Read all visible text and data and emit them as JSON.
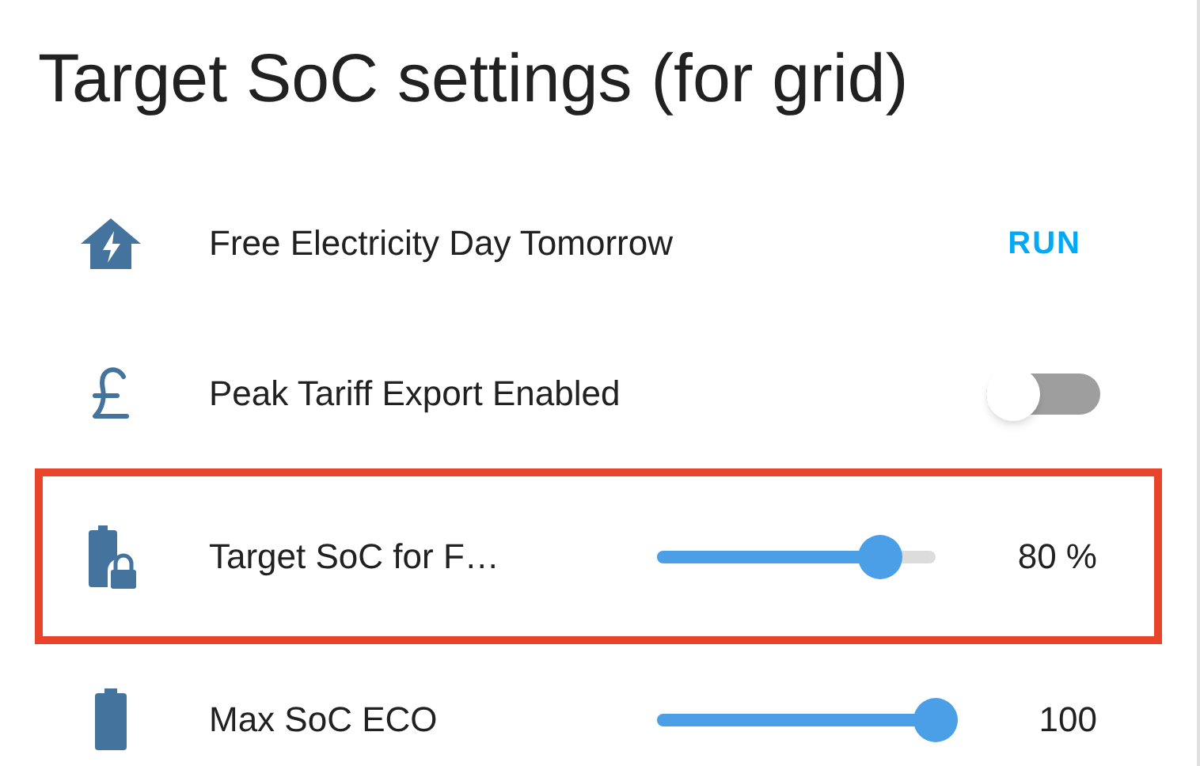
{
  "title": "Target SoC settings (for grid)",
  "rows": [
    {
      "kind": "button",
      "label": "Free Electricity Day Tomorrow",
      "action": "RUN",
      "highlighted": false
    },
    {
      "kind": "toggle",
      "label": "Peak Tariff Export Enabled",
      "on": false,
      "highlighted": false
    },
    {
      "kind": "slider",
      "label": "Target SoC for F…",
      "level": 0.8,
      "reading": "80 %",
      "highlighted": true
    },
    {
      "kind": "slider",
      "label": "Max SoC ECO",
      "level": 1,
      "reading": "100",
      "highlighted": false
    }
  ]
}
